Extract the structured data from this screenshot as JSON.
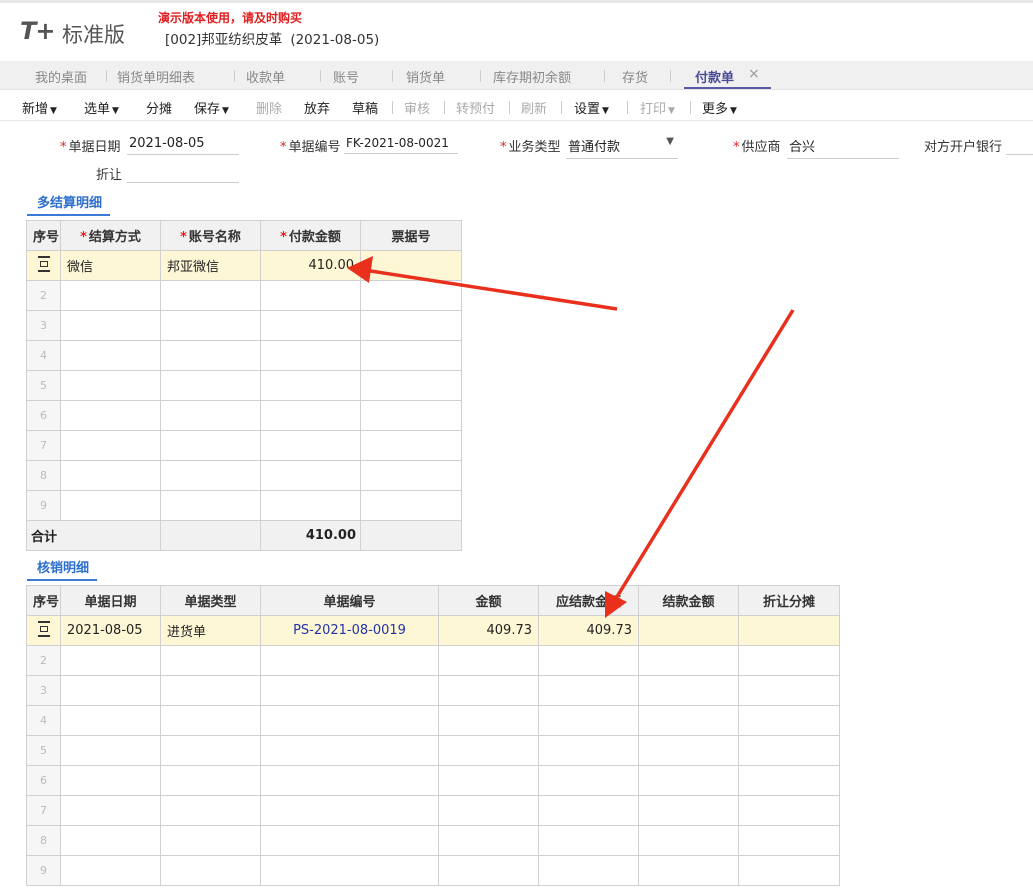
{
  "header": {
    "logo_mark": "T+",
    "logo_text": "标准版",
    "promo": "演示版本使用，请及时购买",
    "company": "[002]邦亚纺织皮革",
    "date": "(2021-08-05)"
  },
  "tabs": [
    {
      "label": "我的桌面"
    },
    {
      "label": "销货单明细表"
    },
    {
      "label": "收款单"
    },
    {
      "label": "账号"
    },
    {
      "label": "销货单"
    },
    {
      "label": "库存期初余额"
    },
    {
      "label": "存货"
    },
    {
      "label": "付款单",
      "active": true,
      "close": "×"
    }
  ],
  "toolbar": {
    "new": "新增",
    "select": "选单",
    "split": "分摊",
    "save": "保存",
    "delete": "删除",
    "discard": "放弃",
    "draft": "草稿",
    "audit": "审核",
    "transfer": "转预付",
    "refresh": "刷新",
    "settings": "设置",
    "print": "打印",
    "more": "更多"
  },
  "form": {
    "date_label": "单据日期",
    "date_value": "2021-08-05",
    "code_label": "单据编号",
    "code_value": "FK-2021-08-0021",
    "biz_label": "业务类型",
    "biz_value": "普通付款",
    "supplier_label": "供应商",
    "supplier_value": "合兴",
    "bank_label": "对方开户银行",
    "discount_label": "折让",
    "discount_value": ""
  },
  "settlement": {
    "title": "多结算明细",
    "headers": {
      "idx": "序号",
      "method": "结算方式",
      "account": "账号名称",
      "amount": "付款金额",
      "ticket": "票据号"
    },
    "row1": {
      "method": "微信",
      "account": "邦亚微信",
      "amount": "410.00",
      "ticket": ""
    },
    "empty_rows": [
      "2",
      "3",
      "4",
      "5",
      "6",
      "7",
      "8",
      "9"
    ],
    "total_label": "合计",
    "total_value": "410.00"
  },
  "verification": {
    "title": "核销明细",
    "headers": {
      "idx": "序号",
      "date": "单据日期",
      "type": "单据类型",
      "code": "单据编号",
      "amount": "金额",
      "due": "应结款金额",
      "settled": "结款金额",
      "discount": "折让分摊"
    },
    "row1": {
      "date": "2021-08-05",
      "type": "进货单",
      "code": "PS-2021-08-0019",
      "amount": "409.73",
      "due": "409.73",
      "settled": "",
      "discount": ""
    },
    "empty_rows": [
      "2",
      "3",
      "4",
      "5",
      "6",
      "7",
      "8",
      "9"
    ]
  },
  "colors": {
    "accent": "#3a7bd5",
    "tab_active": "#5a5aa8",
    "warning": "#e02020",
    "selected_row": "#fdf7d5",
    "annotation_arrow": "#e8301c"
  }
}
